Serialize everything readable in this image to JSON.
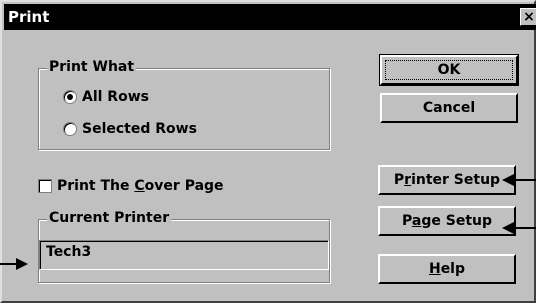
{
  "window": {
    "title": "Print",
    "close_glyph": "×"
  },
  "print_what": {
    "label": "Print What",
    "options": [
      {
        "label": "All Rows",
        "checked": true
      },
      {
        "label": "Selected Rows",
        "checked": false
      }
    ]
  },
  "cover_page": {
    "label_pre": "Print The ",
    "label_mnemonic": "C",
    "label_post": "over Page",
    "checked": false
  },
  "current_printer": {
    "label": "Current Printer",
    "value": "Tech3"
  },
  "buttons": {
    "ok": "OK",
    "cancel": "Cancel",
    "printer_setup": {
      "pre": "P",
      "mnemonic": "r",
      "post": "inter Setup"
    },
    "page_setup": {
      "pre": "P",
      "mnemonic": "a",
      "post": "ge Setup"
    },
    "help": {
      "pre": "",
      "mnemonic": "H",
      "post": "elp"
    }
  }
}
